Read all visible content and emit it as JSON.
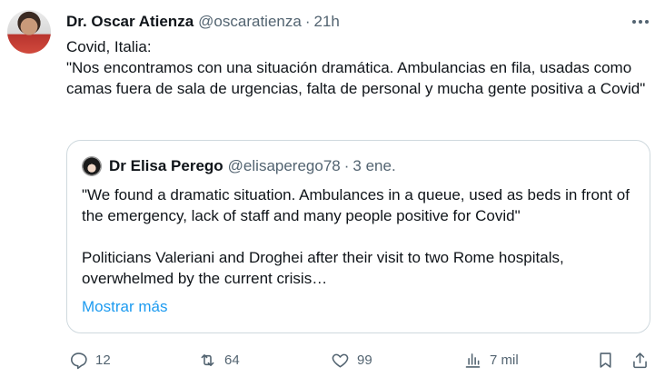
{
  "tweet": {
    "author_name": "Dr. Oscar Atienza",
    "author_handle": "@oscaratienza",
    "separator": "·",
    "time": "21h",
    "text": "Covid, Italia:\n\"Nos encontramos con una situación dramática. Ambulancias en fila, usadas como camas fuera de sala de urgencias, falta de personal y mucha gente positiva a Covid\""
  },
  "quote": {
    "author_name": "Dr Elisa Perego",
    "author_handle": "@elisaperego78",
    "separator": "·",
    "date": "3 ene.",
    "text": "\"We found a dramatic situation. Ambulances in a queue, used as beds in front of the emergency, lack of staff and many people positive for Covid\"\n\nPoliticians Valeriani and Droghei after their visit to two Rome hospitals, overwhelmed by the current crisis…",
    "show_more": "Mostrar más"
  },
  "actions": {
    "replies": "12",
    "retweets": "64",
    "likes": "99",
    "views": "7 mil"
  },
  "icons": {
    "more": "more-horizontal-icon",
    "reply": "reply-icon",
    "retweet": "retweet-icon",
    "like": "heart-icon",
    "views": "views-icon",
    "bookmark": "bookmark-icon",
    "share": "share-icon"
  }
}
